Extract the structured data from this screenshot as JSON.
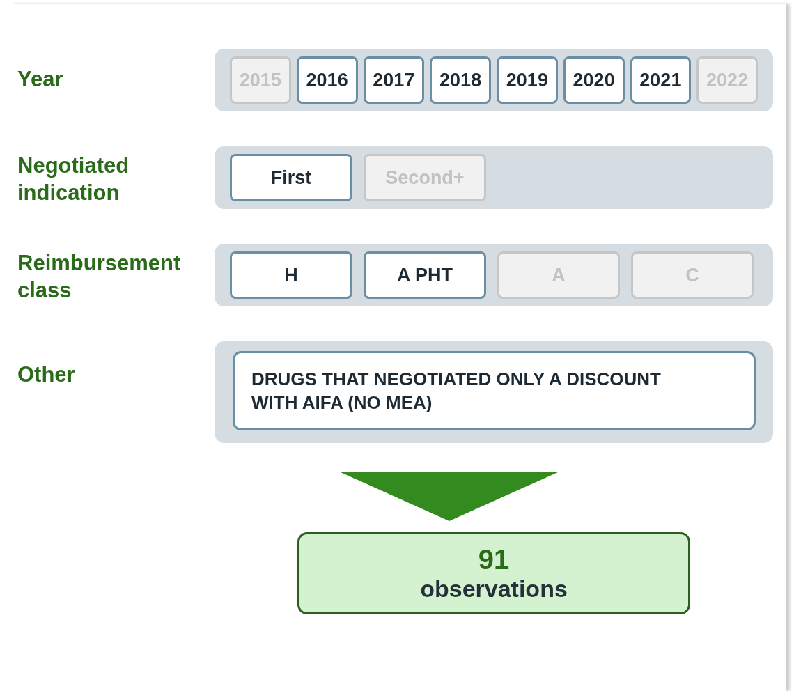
{
  "filters": [
    {
      "label": "Year",
      "kind": "buttons",
      "options": [
        {
          "label": "2015",
          "selected": false
        },
        {
          "label": "2016",
          "selected": true
        },
        {
          "label": "2017",
          "selected": true
        },
        {
          "label": "2018",
          "selected": true
        },
        {
          "label": "2019",
          "selected": true
        },
        {
          "label": "2020",
          "selected": true
        },
        {
          "label": "2021",
          "selected": true
        },
        {
          "label": "2022",
          "selected": false
        }
      ]
    },
    {
      "label": "Negotiated indication",
      "kind": "buttons",
      "options": [
        {
          "label": "First",
          "selected": true
        },
        {
          "label": "Second+",
          "selected": false
        }
      ]
    },
    {
      "label": "Reimbursement class",
      "kind": "buttons",
      "options": [
        {
          "label": "H",
          "selected": true
        },
        {
          "label": "A PHT",
          "selected": true
        },
        {
          "label": "A",
          "selected": false
        },
        {
          "label": "C",
          "selected": false
        }
      ]
    },
    {
      "label": "Other",
      "kind": "text",
      "text": "DRUGS THAT NEGOTIATED ONLY A DISCOUNT WITH AIFA (NO MEA)"
    }
  ],
  "result": {
    "count": "91",
    "label": "observations"
  }
}
